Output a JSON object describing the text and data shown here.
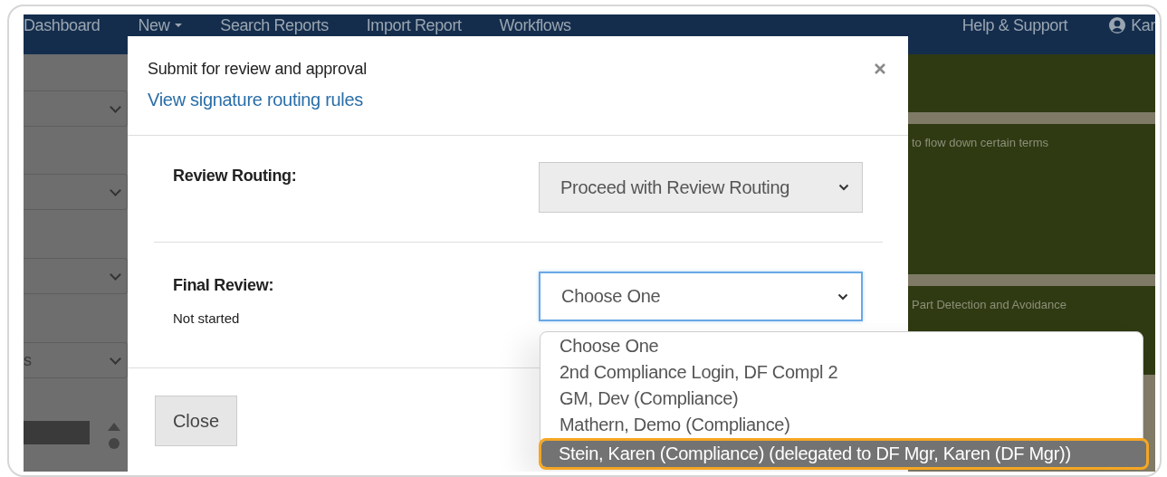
{
  "navbar": {
    "items": [
      {
        "label": "Dashboard",
        "caret": false
      },
      {
        "label": "New",
        "caret": true
      },
      {
        "label": "Search Reports",
        "caret": false
      },
      {
        "label": "Import Report",
        "caret": false
      },
      {
        "label": "Workflows",
        "caret": false
      }
    ],
    "right_items": [
      {
        "label": "Help & Support",
        "icon": false
      },
      {
        "label": "Kar",
        "icon": true
      }
    ]
  },
  "background": {
    "left_select_texts": [
      "s"
    ],
    "right_texts": [
      "to flow down certain terms",
      "Part Detection and Avoidance"
    ]
  },
  "dialog": {
    "title": "Submit for review and approval",
    "link": "View signature routing rules",
    "fields": [
      {
        "label": "Review Routing:",
        "value": "Proceed with Review Routing",
        "disabled": true,
        "focused": false
      },
      {
        "label": "Final Review:",
        "status": "Not started",
        "value": "Choose One",
        "disabled": false,
        "focused": true
      }
    ],
    "close_button": "Close"
  },
  "dropdown": {
    "options": [
      {
        "label": "Choose One",
        "selected": false
      },
      {
        "label": "2nd Compliance Login, DF Compl 2",
        "selected": false
      },
      {
        "label": "GM, Dev (Compliance)",
        "selected": false
      },
      {
        "label": "Mathern, Demo (Compliance)",
        "selected": false
      },
      {
        "label": "Stein, Karen (Compliance) (delegated to DF Mgr, Karen (DF Mgr))",
        "selected": true
      }
    ]
  }
}
